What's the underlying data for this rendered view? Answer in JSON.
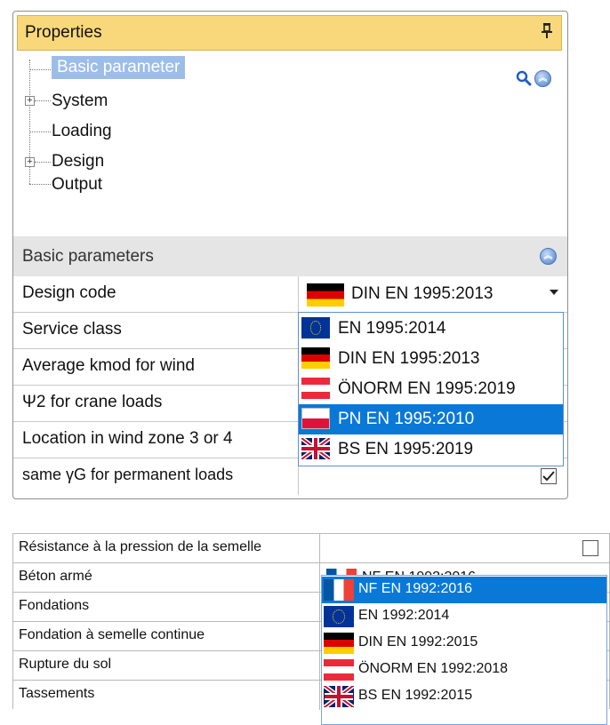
{
  "panel1": {
    "header": {
      "title": "Properties",
      "pin_icon": "pin-icon"
    },
    "tree": {
      "items": [
        {
          "label": "Basic parameter",
          "selected": true,
          "expandable": false
        },
        {
          "label": "System",
          "selected": false,
          "expandable": true
        },
        {
          "label": "Loading",
          "selected": false,
          "expandable": false
        },
        {
          "label": "Design",
          "selected": false,
          "expandable": true
        },
        {
          "label": "Output",
          "selected": false,
          "expandable": false
        }
      ]
    },
    "section": {
      "title": "Basic parameters"
    },
    "rows": [
      {
        "name": "Design code",
        "value": "DIN EN 1995:2013",
        "flag": "de"
      },
      {
        "name": "Service class"
      },
      {
        "name": "Average kmod for wind"
      },
      {
        "name": "Ψ2 for crane loads"
      },
      {
        "name": "Location in wind zone 3 or 4"
      },
      {
        "name": "same γG for permanent loads",
        "checked": true
      }
    ],
    "dropdown": {
      "options": [
        {
          "label": "EN 1995:2014",
          "flag": "eu"
        },
        {
          "label": "DIN EN 1995:2013",
          "flag": "de"
        },
        {
          "label": "ÖNORM EN 1995:2019",
          "flag": "at"
        },
        {
          "label": "PN EN 1995:2010",
          "flag": "pl",
          "highlighted": true
        },
        {
          "label": "BS EN 1995:2019",
          "flag": "uk"
        }
      ]
    }
  },
  "panel2": {
    "rows": [
      {
        "name": "Résistance à la pression de la semelle",
        "checked": false
      },
      {
        "name": "Béton armé",
        "value": "NF EN 1992:2016",
        "flag": "fr"
      },
      {
        "name": "Fondations"
      },
      {
        "name": "Fondation à semelle continue"
      },
      {
        "name": "Rupture du sol"
      },
      {
        "name": "Tassements"
      }
    ],
    "dropdown": {
      "options": [
        {
          "label": "NF EN 1992:2016",
          "flag": "fr",
          "highlighted": true
        },
        {
          "label": "EN 1992:2014",
          "flag": "eu"
        },
        {
          "label": "DIN EN 1992:2015",
          "flag": "de"
        },
        {
          "label": "ÖNORM EN 1992:2018",
          "flag": "at"
        },
        {
          "label": "BS EN 1992:2015",
          "flag": "uk"
        }
      ]
    }
  },
  "colors": {
    "header_bg": "#f8d87a",
    "tree_selection": "#9dbde9",
    "section_bg": "#e5e5e5",
    "dropdown_highlight": "#0a78d7"
  }
}
